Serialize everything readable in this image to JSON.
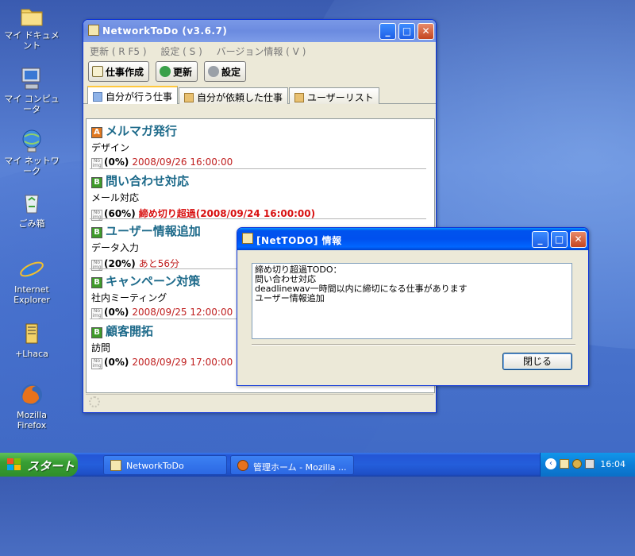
{
  "desktop": {
    "icons": [
      {
        "label": "マイ ドキュメント"
      },
      {
        "label": "マイ コンピュータ"
      },
      {
        "label": "マイ ネットワーク"
      },
      {
        "label": "ごみ箱"
      },
      {
        "label": "Internet Explorer"
      },
      {
        "label": "+Lhaca"
      },
      {
        "label": "Mozilla Firefox"
      }
    ]
  },
  "main_window": {
    "title": "NetworkToDo (v3.6.7)",
    "menu": [
      "更新 ( R  F5 )",
      "設定 ( S )",
      "バージョン情報 ( V )"
    ],
    "toolbar": {
      "create": "仕事作成",
      "refresh": "更新",
      "settings": "設定"
    },
    "tabs": [
      "自分が行う仕事",
      "自分が依頼した仕事",
      "ユーザーリスト"
    ],
    "tasks": [
      {
        "priority": "A",
        "title": "メルマガ発行",
        "category": "デザイン",
        "progress": "(0%)",
        "due": "2008/09/26 16:00:00",
        "overdue": false
      },
      {
        "priority": "B",
        "title": "問い合わせ対応",
        "category": "メール対応",
        "progress": "(60%)",
        "due": "締め切り超過(2008/09/24 16:00:00)",
        "overdue": true
      },
      {
        "priority": "B",
        "title": "ユーザー情報追加",
        "category": "データ入力",
        "progress": "(20%)",
        "due": "あと56分",
        "overdue": false
      },
      {
        "priority": "B",
        "title": "キャンペーン対策",
        "category": "社内ミーティング",
        "progress": "(0%)",
        "due": "2008/09/25 12:00:00",
        "overdue": false
      },
      {
        "priority": "B",
        "title": "顧客開拓",
        "category": "訪問",
        "progress": "(0%)",
        "due": "2008/09/29 17:00:00",
        "overdue": false
      }
    ]
  },
  "dialog": {
    "title": "[NetTODO] 情報",
    "message": "締め切り超過TODO：\n問い合わせ対応\ndeadlinewav一時間以内に締切になる仕事があります\nユーザー情報追加",
    "close_button": "閉じる"
  },
  "taskbar": {
    "start": "スタート",
    "items": [
      "NetworkToDo",
      "管理ホーム - Mozilla ..."
    ],
    "clock": "16:04"
  },
  "colors": {
    "priority_a": "#e07820",
    "priority_b": "#3f9a2a",
    "title_text": "#1d6a8a",
    "due_text": "#c02020"
  }
}
